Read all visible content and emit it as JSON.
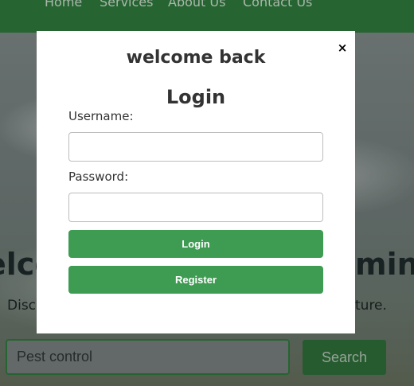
{
  "navbar": {
    "links": [
      "Home",
      "Services",
      "About Us",
      "Contact Us"
    ]
  },
  "hero": {
    "title_left": "elco",
    "title_right": "min",
    "subtitle_left": "Disc",
    "subtitle_right": "ture."
  },
  "search": {
    "placeholder": "Pest control",
    "button_label": "Search"
  },
  "modal": {
    "close_label": "×",
    "heading": "welcome back",
    "subheading": "Login",
    "username_label": "Username:",
    "password_label": "Password:",
    "login_label": "Login",
    "register_label": "Register"
  },
  "colors": {
    "brand_green": "#2f7a3d",
    "button_green": "#3d9b52"
  }
}
